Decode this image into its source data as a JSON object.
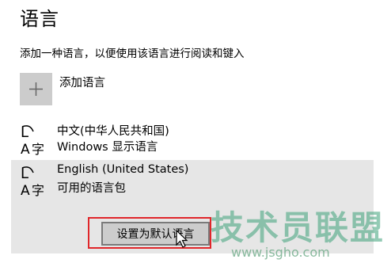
{
  "page": {
    "title": "语言",
    "description": "添加一种语言，以便使用该语言进行阅读和键入"
  },
  "add_language": {
    "label": "添加语言",
    "icon": "plus-icon"
  },
  "languages": [
    {
      "name": "中文(中华人民共和国)",
      "subtitle": "Windows 显示语言",
      "icon": "language-icon"
    },
    {
      "name": "English (United States)",
      "subtitle": "可用的语言包",
      "icon": "language-icon"
    }
  ],
  "buttons": {
    "set_default": "设置为默认语言"
  },
  "watermark": {
    "line1": "技术员联盟",
    "line2": "www.jsgho.com"
  },
  "colors": {
    "selected_row": "#e6e6e6",
    "add_tile": "#cccccc",
    "highlight": "#e0262a"
  }
}
